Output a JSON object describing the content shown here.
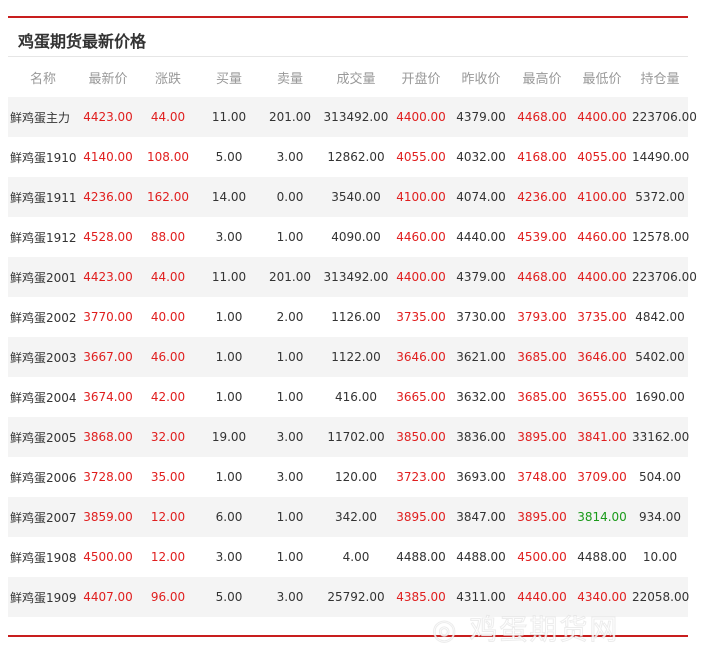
{
  "panel": {
    "title": "鸡蛋期货最新价格"
  },
  "colors": {
    "accent_rule": "#c81e1e",
    "up": "#e01e1e",
    "down": "#1a9a1a",
    "header_text": "#999999",
    "stripe": "#f4f4f4"
  },
  "table": {
    "headers": [
      "名称",
      "最新价",
      "涨跌",
      "买量",
      "卖量",
      "成交量",
      "开盘价",
      "昨收价",
      "最高价",
      "最低价",
      "持仓量"
    ],
    "rows": [
      {
        "name": "鲜鸡蛋主力",
        "last": "4423.00",
        "change": "44.00",
        "bid": "11.00",
        "ask": "201.00",
        "volume": "313492.00",
        "open": "4400.00",
        "prev": "4379.00",
        "high": "4468.00",
        "low": "4400.00",
        "oi": "223706.00",
        "open_dir": "up",
        "high_dir": "up",
        "low_dir": "up"
      },
      {
        "name": "鲜鸡蛋1910",
        "last": "4140.00",
        "change": "108.00",
        "bid": "5.00",
        "ask": "3.00",
        "volume": "12862.00",
        "open": "4055.00",
        "prev": "4032.00",
        "high": "4168.00",
        "low": "4055.00",
        "oi": "14490.00",
        "open_dir": "up",
        "high_dir": "up",
        "low_dir": "up"
      },
      {
        "name": "鲜鸡蛋1911",
        "last": "4236.00",
        "change": "162.00",
        "bid": "14.00",
        "ask": "0.00",
        "volume": "3540.00",
        "open": "4100.00",
        "prev": "4074.00",
        "high": "4236.00",
        "low": "4100.00",
        "oi": "5372.00",
        "open_dir": "up",
        "high_dir": "up",
        "low_dir": "up"
      },
      {
        "name": "鲜鸡蛋1912",
        "last": "4528.00",
        "change": "88.00",
        "bid": "3.00",
        "ask": "1.00",
        "volume": "4090.00",
        "open": "4460.00",
        "prev": "4440.00",
        "high": "4539.00",
        "low": "4460.00",
        "oi": "12578.00",
        "open_dir": "up",
        "high_dir": "up",
        "low_dir": "up"
      },
      {
        "name": "鲜鸡蛋2001",
        "last": "4423.00",
        "change": "44.00",
        "bid": "11.00",
        "ask": "201.00",
        "volume": "313492.00",
        "open": "4400.00",
        "prev": "4379.00",
        "high": "4468.00",
        "low": "4400.00",
        "oi": "223706.00",
        "open_dir": "up",
        "high_dir": "up",
        "low_dir": "up"
      },
      {
        "name": "鲜鸡蛋2002",
        "last": "3770.00",
        "change": "40.00",
        "bid": "1.00",
        "ask": "2.00",
        "volume": "1126.00",
        "open": "3735.00",
        "prev": "3730.00",
        "high": "3793.00",
        "low": "3735.00",
        "oi": "4842.00",
        "open_dir": "up",
        "high_dir": "up",
        "low_dir": "up"
      },
      {
        "name": "鲜鸡蛋2003",
        "last": "3667.00",
        "change": "46.00",
        "bid": "1.00",
        "ask": "1.00",
        "volume": "1122.00",
        "open": "3646.00",
        "prev": "3621.00",
        "high": "3685.00",
        "low": "3646.00",
        "oi": "5402.00",
        "open_dir": "up",
        "high_dir": "up",
        "low_dir": "up"
      },
      {
        "name": "鲜鸡蛋2004",
        "last": "3674.00",
        "change": "42.00",
        "bid": "1.00",
        "ask": "1.00",
        "volume": "416.00",
        "open": "3665.00",
        "prev": "3632.00",
        "high": "3685.00",
        "low": "3655.00",
        "oi": "1690.00",
        "open_dir": "up",
        "high_dir": "up",
        "low_dir": "up"
      },
      {
        "name": "鲜鸡蛋2005",
        "last": "3868.00",
        "change": "32.00",
        "bid": "19.00",
        "ask": "3.00",
        "volume": "11702.00",
        "open": "3850.00",
        "prev": "3836.00",
        "high": "3895.00",
        "low": "3841.00",
        "oi": "33162.00",
        "open_dir": "up",
        "high_dir": "up",
        "low_dir": "up"
      },
      {
        "name": "鲜鸡蛋2006",
        "last": "3728.00",
        "change": "35.00",
        "bid": "1.00",
        "ask": "3.00",
        "volume": "120.00",
        "open": "3723.00",
        "prev": "3693.00",
        "high": "3748.00",
        "low": "3709.00",
        "oi": "504.00",
        "open_dir": "up",
        "high_dir": "up",
        "low_dir": "up"
      },
      {
        "name": "鲜鸡蛋2007",
        "last": "3859.00",
        "change": "12.00",
        "bid": "6.00",
        "ask": "1.00",
        "volume": "342.00",
        "open": "3895.00",
        "prev": "3847.00",
        "high": "3895.00",
        "low": "3814.00",
        "oi": "934.00",
        "open_dir": "up",
        "high_dir": "up",
        "low_dir": "down"
      },
      {
        "name": "鲜鸡蛋1908",
        "last": "4500.00",
        "change": "12.00",
        "bid": "3.00",
        "ask": "1.00",
        "volume": "4.00",
        "open": "4488.00",
        "prev": "4488.00",
        "high": "4500.00",
        "low": "4488.00",
        "oi": "10.00",
        "open_dir": "flat",
        "high_dir": "up",
        "low_dir": "flat"
      },
      {
        "name": "鲜鸡蛋1909",
        "last": "4407.00",
        "change": "96.00",
        "bid": "5.00",
        "ask": "3.00",
        "volume": "25792.00",
        "open": "4385.00",
        "prev": "4311.00",
        "high": "4440.00",
        "low": "4340.00",
        "oi": "22058.00",
        "open_dir": "up",
        "high_dir": "up",
        "low_dir": "up"
      }
    ]
  }
}
